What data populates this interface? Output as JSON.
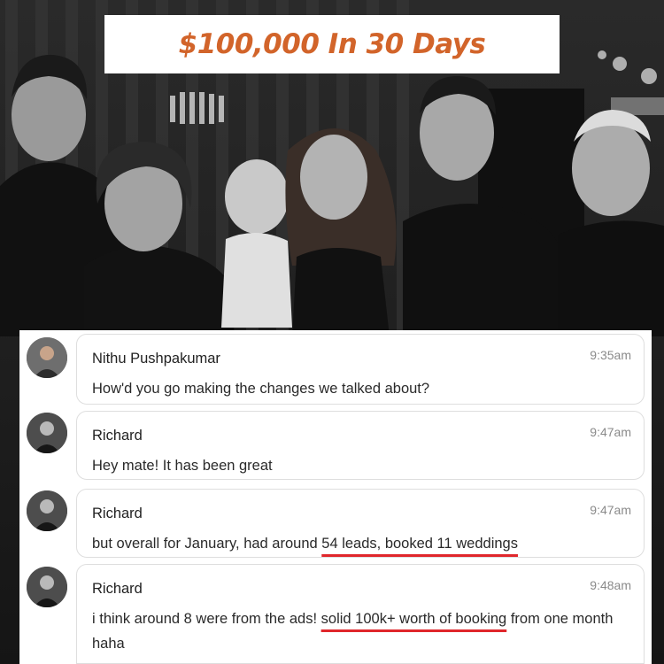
{
  "headline": "$100,000 In 30 Days",
  "colors": {
    "headline_text": "#d2642a",
    "underline": "#e0262b",
    "photo_bg": "#1c1c1c"
  },
  "messages": [
    {
      "sender": "Nithu Pushpakumar",
      "time": "9:35am",
      "text_before": "How'd you go making the changes we talked about?",
      "highlight": "",
      "text_after": "",
      "avatar": "avatar-nithu"
    },
    {
      "sender": "Richard",
      "time": "9:47am",
      "text_before": "Hey mate! It has been great",
      "highlight": "",
      "text_after": "",
      "avatar": "avatar-richard"
    },
    {
      "sender": "Richard",
      "time": "9:47am",
      "text_before": "but overall for January, had around ",
      "highlight": "54 leads, booked 11 weddings",
      "text_after": "",
      "avatar": "avatar-richard"
    },
    {
      "sender": "Richard",
      "time": "9:48am",
      "text_before": "i think around 8 were from the ads! ",
      "highlight": "solid 100k+ worth of booking",
      "text_after": " from one month haha",
      "avatar": "avatar-richard"
    }
  ]
}
